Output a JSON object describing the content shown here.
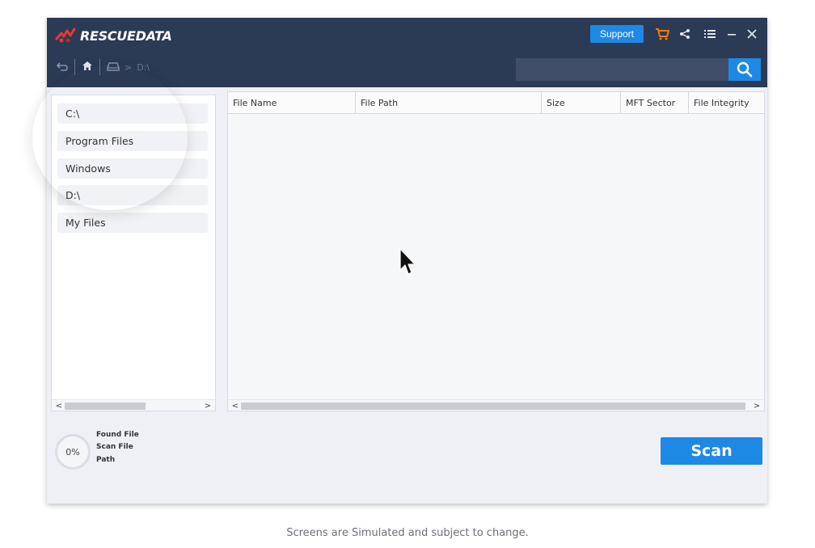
{
  "app": {
    "logo_text": "RESCUEDATA",
    "support_label": "Support",
    "accent_color": "#1e88e5",
    "titlebar_color": "#2b3a55"
  },
  "titlebar_icons": [
    "cart-icon",
    "share-icon",
    "menu-icon",
    "minimize-icon",
    "close-icon"
  ],
  "nav": {
    "breadcrumb": "D:\\"
  },
  "search": {
    "placeholder": ""
  },
  "sidebar": {
    "items": [
      {
        "label": "C:\\"
      },
      {
        "label": "Program Files"
      },
      {
        "label": "Windows"
      },
      {
        "label": "D:\\"
      },
      {
        "label": "My Files"
      }
    ]
  },
  "table": {
    "columns": [
      "File Name",
      "File Path",
      "Size",
      "MFT Sector",
      "File Integrity"
    ]
  },
  "status": {
    "progress": "0%",
    "found_file": "Found File",
    "scan_file": "Scan File",
    "path": "Path"
  },
  "scan_label": "Scan",
  "footer_note": "Screens are Simulated and subject to change."
}
